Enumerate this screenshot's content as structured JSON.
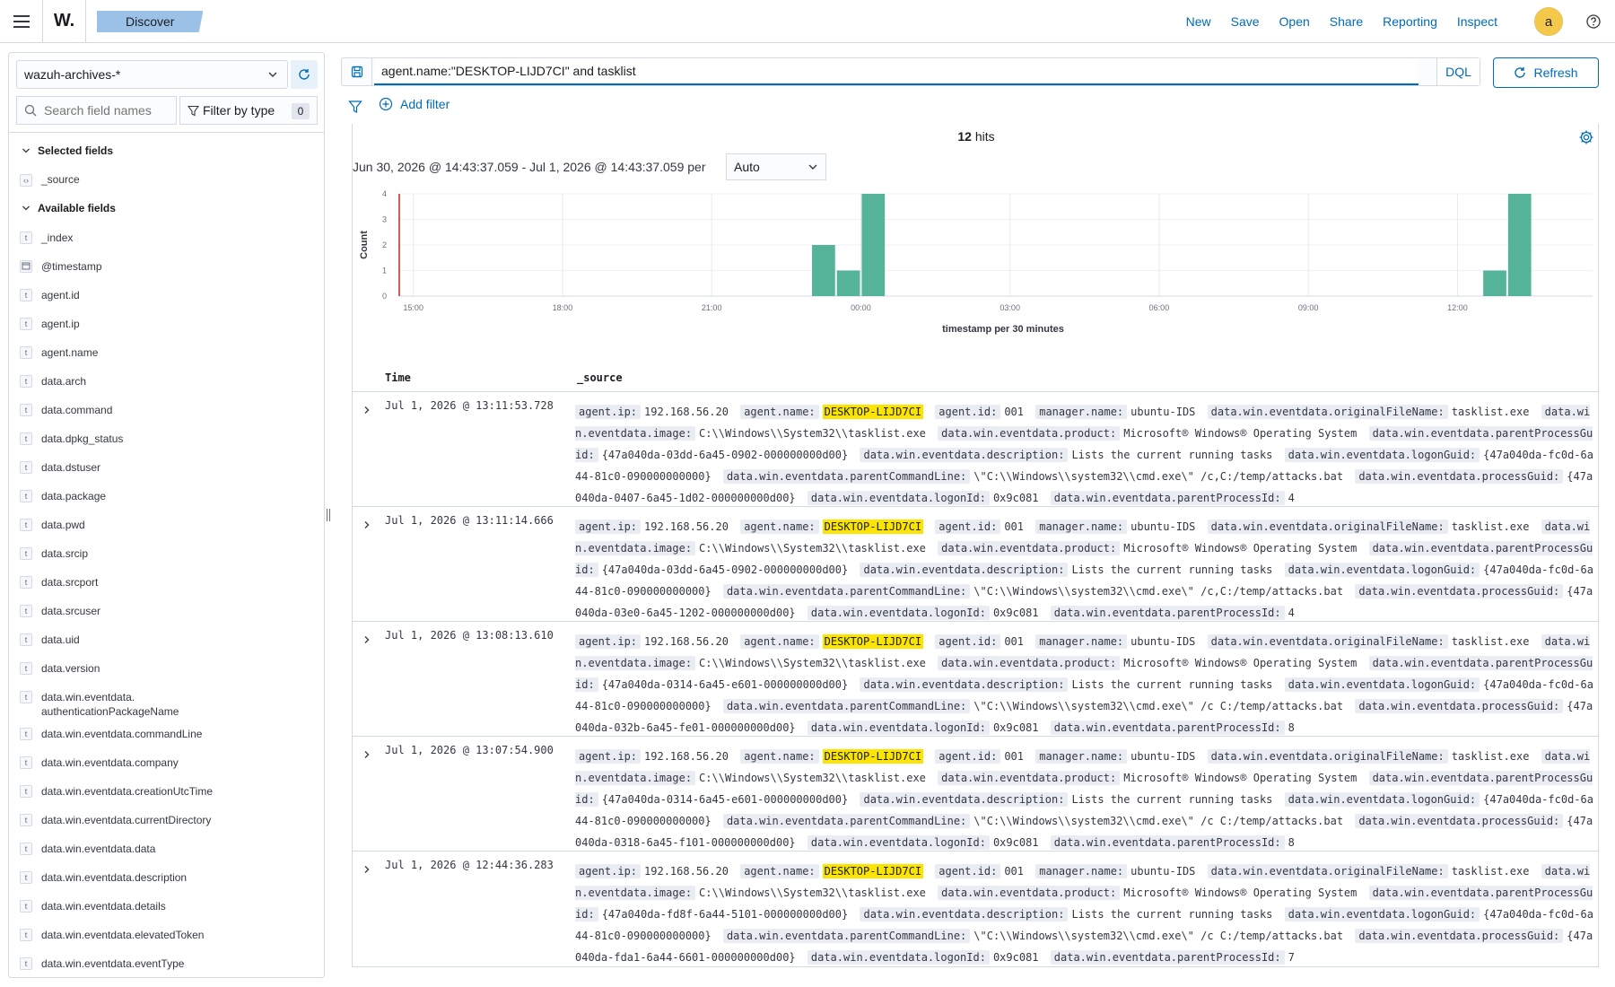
{
  "app": {
    "logo": "W.",
    "breadcrumb": "Discover",
    "nav": [
      "New",
      "Save",
      "Open",
      "Share",
      "Reporting",
      "Inspect"
    ],
    "avatar": "a"
  },
  "sidebar": {
    "index_pattern": "wazuh-archives-*",
    "search_placeholder": "Search field names",
    "filter_label": "Filter by type",
    "filter_count": "0",
    "selected_title": "Selected fields",
    "selected": [
      "_source"
    ],
    "available_title": "Available fields",
    "fields": [
      {
        "name": "_index",
        "type": "t"
      },
      {
        "name": "@timestamp",
        "type": "date"
      },
      {
        "name": "agent.id",
        "type": "t"
      },
      {
        "name": "agent.ip",
        "type": "t"
      },
      {
        "name": "agent.name",
        "type": "t"
      },
      {
        "name": "data.arch",
        "type": "t"
      },
      {
        "name": "data.command",
        "type": "t"
      },
      {
        "name": "data.dpkg_status",
        "type": "t"
      },
      {
        "name": "data.dstuser",
        "type": "t"
      },
      {
        "name": "data.package",
        "type": "t"
      },
      {
        "name": "data.pwd",
        "type": "t"
      },
      {
        "name": "data.srcip",
        "type": "t"
      },
      {
        "name": "data.srcport",
        "type": "t"
      },
      {
        "name": "data.srcuser",
        "type": "t"
      },
      {
        "name": "data.uid",
        "type": "t"
      },
      {
        "name": "data.version",
        "type": "t"
      },
      {
        "name": "data.win.eventdata.\nauthenticationPackageName",
        "type": "t"
      },
      {
        "name": "data.win.eventdata.commandLine",
        "type": "t"
      },
      {
        "name": "data.win.eventdata.company",
        "type": "t"
      },
      {
        "name": "data.win.eventdata.creationUtcTime",
        "type": "t"
      },
      {
        "name": "data.win.eventdata.currentDirectory",
        "type": "t"
      },
      {
        "name": "data.win.eventdata.data",
        "type": "t"
      },
      {
        "name": "data.win.eventdata.description",
        "type": "t"
      },
      {
        "name": "data.win.eventdata.details",
        "type": "t"
      },
      {
        "name": "data.win.eventdata.elevatedToken",
        "type": "t"
      },
      {
        "name": "data.win.eventdata.eventType",
        "type": "t"
      }
    ]
  },
  "query": {
    "text": "agent.name:\"DESKTOP-LIJD7CI\" and tasklist",
    "language": "DQL",
    "refresh_label": "Refresh",
    "add_filter_label": "Add filter"
  },
  "results": {
    "hits_count": "12",
    "hits_label": "hits",
    "time_range": "Jun 30, 2026 @ 14:43:37.059 - Jul 1, 2026 @ 14:43:37.059 per",
    "interval": "Auto"
  },
  "chart_data": {
    "type": "bar",
    "ylabel": "Count",
    "xlabel": "timestamp per 30 minutes",
    "ylim": [
      0,
      4
    ],
    "yticks": [
      0,
      1,
      2,
      3,
      4
    ],
    "x_domain_hours": [
      14.75,
      14.75
    ],
    "xticks": [
      "15:00",
      "18:00",
      "21:00",
      "00:00",
      "03:00",
      "06:00",
      "09:00",
      "12:00"
    ],
    "bars": [
      {
        "x": "23:00",
        "value": 2
      },
      {
        "x": "23:30",
        "value": 1
      },
      {
        "x": "00:00",
        "value": 4
      },
      {
        "x": "12:30",
        "value": 1
      },
      {
        "x": "13:00",
        "value": 4
      }
    ],
    "now_marker": "14:43",
    "grid": true
  },
  "table": {
    "col_time": "Time",
    "col_source": "_source",
    "rows": [
      {
        "time": "Jul 1, 2026 @ 13:11:53.728",
        "fields": [
          [
            "agent.ip:",
            "192.168.56.20"
          ],
          [
            "agent.name:",
            "DESKTOP-LIJD7CI",
            true
          ],
          [
            "agent.id:",
            "001"
          ],
          [
            "manager.name:",
            "ubuntu-IDS"
          ],
          [
            "data.win.eventdata.originalFileName:",
            "tasklist.exe"
          ],
          [
            "data.win.eventdata.image:",
            "C:\\\\Windows\\\\System32\\\\tasklist.exe"
          ],
          [
            "data.win.eventdata.product:",
            "Microsoft® Windows® Operating System"
          ],
          [
            "data.win.eventdata.parentProcessGuid:",
            "{47a040da-03dd-6a45-0902-000000000d00}"
          ],
          [
            "data.win.eventdata.description:",
            "Lists the current running tasks"
          ],
          [
            "data.win.eventdata.logonGuid:",
            "{47a040da-fc0d-6a44-81c0-090000000000}"
          ],
          [
            "data.win.eventdata.parentCommandLine:",
            "\\\"C:\\\\Windows\\\\system32\\\\cmd.exe\\\" /c,C:/temp/attacks.bat"
          ],
          [
            "data.win.eventdata.processGuid:",
            "{47a040da-0407-6a45-1d02-000000000d00}"
          ],
          [
            "data.win.eventdata.logonId:",
            "0x9c081"
          ],
          [
            "data.win.eventdata.parentProcessId:",
            "4"
          ]
        ]
      },
      {
        "time": "Jul 1, 2026 @ 13:11:14.666",
        "fields": [
          [
            "agent.ip:",
            "192.168.56.20"
          ],
          [
            "agent.name:",
            "DESKTOP-LIJD7CI",
            true
          ],
          [
            "agent.id:",
            "001"
          ],
          [
            "manager.name:",
            "ubuntu-IDS"
          ],
          [
            "data.win.eventdata.originalFileName:",
            "tasklist.exe"
          ],
          [
            "data.win.eventdata.image:",
            "C:\\\\Windows\\\\System32\\\\tasklist.exe"
          ],
          [
            "data.win.eventdata.product:",
            "Microsoft® Windows® Operating System"
          ],
          [
            "data.win.eventdata.parentProcessGuid:",
            "{47a040da-03dd-6a45-0902-000000000d00}"
          ],
          [
            "data.win.eventdata.description:",
            "Lists the current running tasks"
          ],
          [
            "data.win.eventdata.logonGuid:",
            "{47a040da-fc0d-6a44-81c0-090000000000}"
          ],
          [
            "data.win.eventdata.parentCommandLine:",
            "\\\"C:\\\\Windows\\\\system32\\\\cmd.exe\\\" /c,C:/temp/attacks.bat"
          ],
          [
            "data.win.eventdata.processGuid:",
            "{47a040da-03e0-6a45-1202-000000000d00}"
          ],
          [
            "data.win.eventdata.logonId:",
            "0x9c081"
          ],
          [
            "data.win.eventdata.parentProcessId:",
            "4"
          ]
        ]
      },
      {
        "time": "Jul 1, 2026 @ 13:08:13.610",
        "fields": [
          [
            "agent.ip:",
            "192.168.56.20"
          ],
          [
            "agent.name:",
            "DESKTOP-LIJD7CI",
            true
          ],
          [
            "agent.id:",
            "001"
          ],
          [
            "manager.name:",
            "ubuntu-IDS"
          ],
          [
            "data.win.eventdata.originalFileName:",
            "tasklist.exe"
          ],
          [
            "data.win.eventdata.image:",
            "C:\\\\Windows\\\\System32\\\\tasklist.exe"
          ],
          [
            "data.win.eventdata.product:",
            "Microsoft® Windows® Operating System"
          ],
          [
            "data.win.eventdata.parentProcessGuid:",
            "{47a040da-0314-6a45-e601-000000000d00}"
          ],
          [
            "data.win.eventdata.description:",
            "Lists the current running tasks"
          ],
          [
            "data.win.eventdata.logonGuid:",
            "{47a040da-fc0d-6a44-81c0-090000000000}"
          ],
          [
            "data.win.eventdata.parentCommandLine:",
            "\\\"C:\\\\Windows\\\\system32\\\\cmd.exe\\\" /c C:/temp/attacks.bat"
          ],
          [
            "data.win.eventdata.processGuid:",
            "{47a040da-032b-6a45-fe01-000000000d00}"
          ],
          [
            "data.win.eventdata.logonId:",
            "0x9c081"
          ],
          [
            "data.win.eventdata.parentProcessId:",
            "8"
          ]
        ]
      },
      {
        "time": "Jul 1, 2026 @ 13:07:54.900",
        "fields": [
          [
            "agent.ip:",
            "192.168.56.20"
          ],
          [
            "agent.name:",
            "DESKTOP-LIJD7CI",
            true
          ],
          [
            "agent.id:",
            "001"
          ],
          [
            "manager.name:",
            "ubuntu-IDS"
          ],
          [
            "data.win.eventdata.originalFileName:",
            "tasklist.exe"
          ],
          [
            "data.win.eventdata.image:",
            "C:\\\\Windows\\\\System32\\\\tasklist.exe"
          ],
          [
            "data.win.eventdata.product:",
            "Microsoft® Windows® Operating System"
          ],
          [
            "data.win.eventdata.parentProcessGuid:",
            "{47a040da-0314-6a45-e601-000000000d00}"
          ],
          [
            "data.win.eventdata.description:",
            "Lists the current running tasks"
          ],
          [
            "data.win.eventdata.logonGuid:",
            "{47a040da-fc0d-6a44-81c0-090000000000}"
          ],
          [
            "data.win.eventdata.parentCommandLine:",
            "\\\"C:\\\\Windows\\\\system32\\\\cmd.exe\\\" /c C:/temp/attacks.bat"
          ],
          [
            "data.win.eventdata.processGuid:",
            "{47a040da-0318-6a45-f101-000000000d00}"
          ],
          [
            "data.win.eventdata.logonId:",
            "0x9c081"
          ],
          [
            "data.win.eventdata.parentProcessId:",
            "8"
          ]
        ]
      },
      {
        "time": "Jul 1, 2026 @ 12:44:36.283",
        "fields": [
          [
            "agent.ip:",
            "192.168.56.20"
          ],
          [
            "agent.name:",
            "DESKTOP-LIJD7CI",
            true
          ],
          [
            "agent.id:",
            "001"
          ],
          [
            "manager.name:",
            "ubuntu-IDS"
          ],
          [
            "data.win.eventdata.originalFileName:",
            "tasklist.exe"
          ],
          [
            "data.win.eventdata.image:",
            "C:\\\\Windows\\\\System32\\\\tasklist.exe"
          ],
          [
            "data.win.eventdata.product:",
            "Microsoft® Windows® Operating System"
          ],
          [
            "data.win.eventdata.parentProcessGuid:",
            "{47a040da-fd8f-6a44-5101-000000000d00}"
          ],
          [
            "data.win.eventdata.description:",
            "Lists the current running tasks"
          ],
          [
            "data.win.eventdata.logonGuid:",
            "{47a040da-fc0d-6a44-81c0-090000000000}"
          ],
          [
            "data.win.eventdata.parentCommandLine:",
            "\\\"C:\\\\Windows\\\\system32\\\\cmd.exe\\\" /c C:/temp/attacks.bat"
          ],
          [
            "data.win.eventdata.processGuid:",
            "{47a040da-fda1-6a44-6601-000000000d00}"
          ],
          [
            "data.win.eventdata.logonId:",
            "0x9c081"
          ],
          [
            "data.win.eventdata.parentProcessId:",
            "7"
          ]
        ]
      }
    ]
  },
  "colors": {
    "accent": "#006bb8",
    "bar": "#54b399",
    "highlight": "#fbe400",
    "now_line": "#bd271e",
    "breadcrumb_bg": "#9bc2e6"
  }
}
